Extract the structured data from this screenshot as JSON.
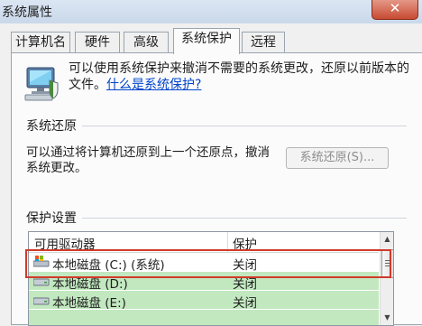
{
  "window": {
    "title": "系统属性",
    "close_glyph": "✕"
  },
  "tabs": [
    {
      "label": "计算机名"
    },
    {
      "label": "硬件"
    },
    {
      "label": "高级"
    },
    {
      "label": "系统保护"
    },
    {
      "label": "远程"
    }
  ],
  "intro": {
    "text": "可以使用系统保护来撤消不需要的系统更改，还原以前版本的文件。",
    "link": "什么是系统保护?"
  },
  "restore": {
    "section_title": "系统还原",
    "description": "可以通过将计算机还原到上一个还原点，撤消系统更改。",
    "button": "系统还原(S)..."
  },
  "protection": {
    "section_title": "保护设置",
    "columns": {
      "drive": "可用驱动器",
      "protection": "保护"
    },
    "rows": [
      {
        "name": "本地磁盘 (C:) (系统)",
        "protection": "关闭",
        "icon": "system-drive-icon"
      },
      {
        "name": "本地磁盘 (D:)",
        "protection": "关闭",
        "icon": "drive-icon"
      },
      {
        "name": "本地磁盘 (E:)",
        "protection": "关闭",
        "icon": "drive-icon"
      }
    ]
  },
  "colors": {
    "highlight_border": "#d13a2a",
    "row_green": "#c2e8c0",
    "link": "#0044cc"
  }
}
